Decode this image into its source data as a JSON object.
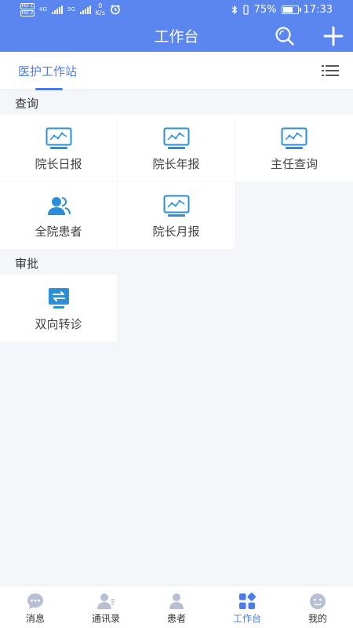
{
  "status_bar": {
    "hd1": "HD 1",
    "hd2": "HD 2",
    "net1": "4G",
    "net2": "5G",
    "speed_value": "0",
    "speed_unit": "K/s",
    "battery_percent": "75%",
    "battery_level": 0.75,
    "time": "17:33"
  },
  "header": {
    "title": "工作台"
  },
  "tabs": {
    "active_label": "医护工作站"
  },
  "sections": [
    {
      "label": "查询",
      "items": [
        {
          "label": "院长日报",
          "icon": "monitor-chart-icon"
        },
        {
          "label": "院长年报",
          "icon": "monitor-chart-icon"
        },
        {
          "label": "主任查询",
          "icon": "monitor-chart-icon"
        },
        {
          "label": "全院患者",
          "icon": "patients-icon"
        },
        {
          "label": "院长月报",
          "icon": "monitor-chart-icon"
        }
      ]
    },
    {
      "label": "审批",
      "items": [
        {
          "label": "双向转诊",
          "icon": "transfer-icon"
        }
      ]
    }
  ],
  "bottom_nav": [
    {
      "label": "消息",
      "icon": "chat-icon",
      "active": false
    },
    {
      "label": "通讯录",
      "icon": "contacts-icon",
      "active": false
    },
    {
      "label": "患者",
      "icon": "patient-icon",
      "active": false
    },
    {
      "label": "工作台",
      "icon": "workbench-icon",
      "active": true
    },
    {
      "label": "我的",
      "icon": "profile-icon",
      "active": false
    }
  ],
  "colors": {
    "primary": "#5b86f0",
    "active_text": "#4e7bea",
    "icon_blue": "#2a8fd8",
    "nav_gray": "#b8bfd2"
  }
}
